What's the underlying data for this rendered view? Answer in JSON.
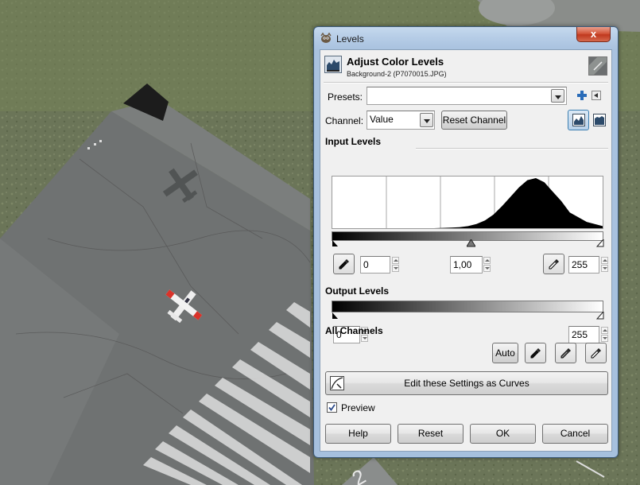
{
  "window": {
    "title": "Levels",
    "close_glyph": "x"
  },
  "header": {
    "title": "Adjust Color Levels",
    "subtitle": "Background-2 (P7070015.JPG)",
    "icon": "levels-icon"
  },
  "presets": {
    "label": "Presets:",
    "value": "",
    "add_icon": "plus-icon",
    "menu_icon": "triangle-left-icon"
  },
  "channel": {
    "label": "Channel:",
    "value": "Value",
    "reset_label": "Reset Channel",
    "linear_icon": "linear-histogram-icon",
    "log_icon": "logarithmic-histogram-icon"
  },
  "input_levels": {
    "heading": "Input Levels",
    "low": "0",
    "gamma": "1,00",
    "high": "255"
  },
  "output_levels": {
    "heading": "Output Levels",
    "low": "0",
    "high": "255"
  },
  "all_channels": {
    "heading": "All Channels",
    "auto_label": "Auto"
  },
  "curves_button": {
    "label": "Edit these Settings as Curves"
  },
  "preview": {
    "label": "Preview",
    "checked": true
  },
  "buttons": {
    "help": "Help",
    "reset": "Reset",
    "ok": "OK",
    "cancel": "Cancel"
  },
  "colors": {
    "window_frame": "#a6c0de",
    "close_button": "#c9472b",
    "dialog_bg": "#f0f0f0",
    "runway": "#6f7272",
    "grass": "#6b7558"
  },
  "chart_data": {
    "type": "area",
    "x": [
      0,
      16,
      32,
      48,
      64,
      80,
      96,
      112,
      120,
      128,
      136,
      144,
      152,
      160,
      168,
      176,
      184,
      192,
      200,
      208,
      216,
      224,
      240,
      255
    ],
    "values": [
      0,
      0,
      0,
      0,
      0,
      0,
      0,
      1,
      2,
      4,
      8,
      15,
      26,
      42,
      60,
      78,
      92,
      96,
      88,
      70,
      52,
      30,
      12,
      4
    ],
    "xlim": [
      0,
      255
    ],
    "grid": true
  }
}
